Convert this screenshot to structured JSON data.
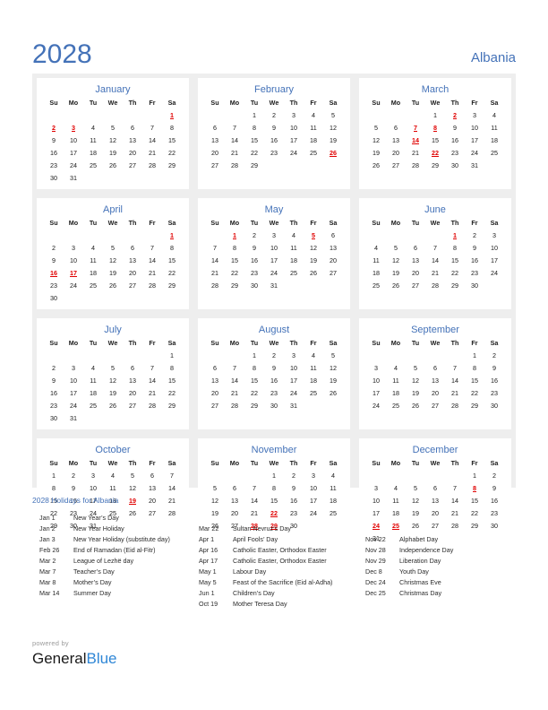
{
  "header": {
    "year": "2028",
    "country": "Albania"
  },
  "colors": {
    "accent_blue": "#4472b8",
    "holiday_red": "#e00000",
    "panel_gray": "#eeeeee",
    "logo_blue": "#2e86d6"
  },
  "weekday_headers": [
    "Su",
    "Mo",
    "Tu",
    "We",
    "Th",
    "Fr",
    "Sa"
  ],
  "months": [
    {
      "name": "January",
      "first_weekday": 6,
      "days_in_month": 31,
      "holidays": [
        1,
        2,
        3
      ]
    },
    {
      "name": "February",
      "first_weekday": 2,
      "days_in_month": 29,
      "holidays": [
        26
      ]
    },
    {
      "name": "March",
      "first_weekday": 3,
      "days_in_month": 31,
      "holidays": [
        2,
        7,
        8,
        14,
        22
      ]
    },
    {
      "name": "April",
      "first_weekday": 6,
      "days_in_month": 30,
      "holidays": [
        1,
        16,
        17
      ]
    },
    {
      "name": "May",
      "first_weekday": 1,
      "days_in_month": 31,
      "holidays": [
        1,
        5
      ]
    },
    {
      "name": "June",
      "first_weekday": 4,
      "days_in_month": 30,
      "holidays": [
        1
      ]
    },
    {
      "name": "July",
      "first_weekday": 6,
      "days_in_month": 31,
      "holidays": []
    },
    {
      "name": "August",
      "first_weekday": 2,
      "days_in_month": 31,
      "holidays": []
    },
    {
      "name": "September",
      "first_weekday": 5,
      "days_in_month": 30,
      "holidays": []
    },
    {
      "name": "October",
      "first_weekday": 0,
      "days_in_month": 31,
      "holidays": [
        19
      ]
    },
    {
      "name": "November",
      "first_weekday": 3,
      "days_in_month": 30,
      "holidays": [
        22,
        28,
        29
      ]
    },
    {
      "name": "December",
      "first_weekday": 5,
      "days_in_month": 31,
      "holidays": [
        8,
        24,
        25
      ]
    }
  ],
  "holidays_section": {
    "title": "2028 Holidays for Albania",
    "columns": [
      [
        {
          "date": "Jan 1",
          "name": "New Year’s Day"
        },
        {
          "date": "Jan 2",
          "name": "New Year Holiday"
        },
        {
          "date": "Jan 3",
          "name": "New Year Holiday (substitute day)"
        },
        {
          "date": "Feb 26",
          "name": "End of Ramadan (Eid al-Fitr)"
        },
        {
          "date": "Mar 2",
          "name": "League of Lezhë day"
        },
        {
          "date": "Mar 7",
          "name": "Teacher’s Day"
        },
        {
          "date": "Mar 8",
          "name": "Mother’s Day"
        },
        {
          "date": "Mar 14",
          "name": "Summer Day"
        }
      ],
      [
        {
          "date": "Mar 22",
          "name": "Sultan Nevruz’s Day"
        },
        {
          "date": "Apr 1",
          "name": "April Fools’ Day"
        },
        {
          "date": "Apr 16",
          "name": "Catholic Easter, Orthodox Easter"
        },
        {
          "date": "Apr 17",
          "name": "Catholic Easter, Orthodox Easter"
        },
        {
          "date": "May 1",
          "name": "Labour Day"
        },
        {
          "date": "May 5",
          "name": "Feast of the Sacrifice (Eid al-Adha)"
        },
        {
          "date": "Jun 1",
          "name": "Children’s Day"
        },
        {
          "date": "Oct 19",
          "name": "Mother Teresa Day"
        }
      ],
      [
        {
          "date": "Nov 22",
          "name": "Alphabet Day"
        },
        {
          "date": "Nov 28",
          "name": "Independence Day"
        },
        {
          "date": "Nov 29",
          "name": "Liberation Day"
        },
        {
          "date": "Dec 8",
          "name": "Youth Day"
        },
        {
          "date": "Dec 24",
          "name": "Christmas Eve"
        },
        {
          "date": "Dec 25",
          "name": "Christmas Day"
        }
      ]
    ]
  },
  "footer": {
    "powered_by": "powered by",
    "logo_part1": "General",
    "logo_part2": "Blue"
  }
}
